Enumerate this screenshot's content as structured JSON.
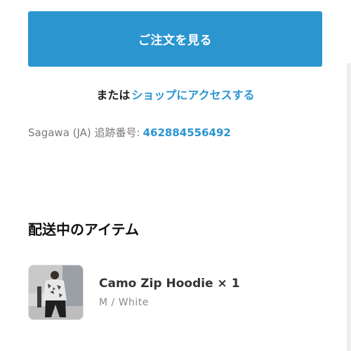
{
  "actions": {
    "view_orders_label": "ご注文を見る",
    "or_prefix": "または",
    "shop_link_label": "ショップにアクセスする"
  },
  "shipping": {
    "tracking_label": "Sagawa (JA) 追跡番号:",
    "tracking_number": "462884556492"
  },
  "items_section": {
    "title": "配送中のアイテム",
    "items": [
      {
        "name": "Camo Zip Hoodie × 1",
        "variant": "M / White"
      }
    ]
  },
  "colors": {
    "accent": "#2b95d0",
    "text_dark": "#1c1c1c",
    "text_muted": "#7a7a7a"
  }
}
